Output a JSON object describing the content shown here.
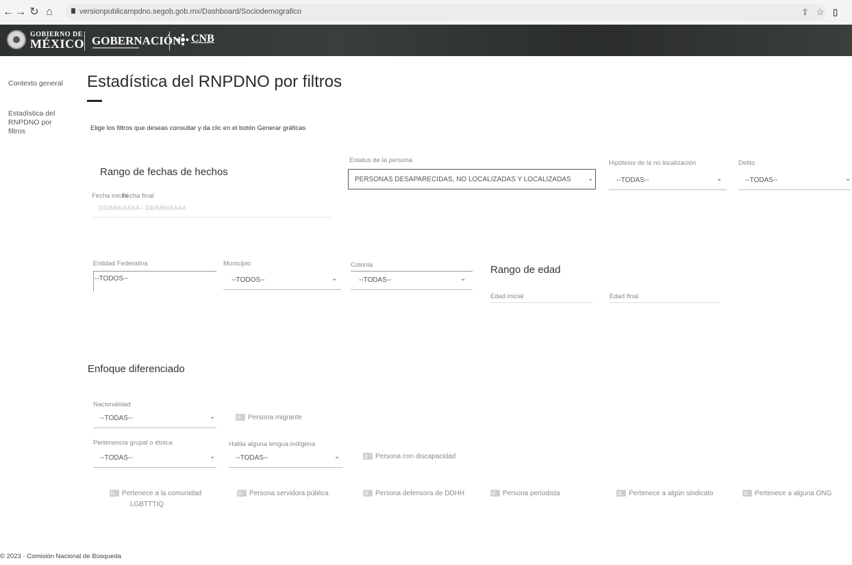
{
  "browser": {
    "url": "versionpublicampdno.segob.gob.mx/Dashboard/Sociodemografico",
    "icons": [
      "back-icon",
      "forward-icon",
      "reload-icon",
      "home-icon",
      "lock-icon",
      "share-icon",
      "star-icon",
      "sidebar-icon"
    ]
  },
  "header": {
    "gob_line1": "GOBIERNO DE",
    "gob_line2": "MÉXICO",
    "gobernacion": "GOBERNACIÓN",
    "cnb": "CNB"
  },
  "sidebar": {
    "items": [
      {
        "label": "Contexto general"
      },
      {
        "label": "Estadística del RNPDNO por filtros"
      }
    ]
  },
  "main": {
    "title": "Estadística del RNPDNO por filtros",
    "instructions": "Elige los filtros que deseas consultar y da clic en el botón Generar gráficas",
    "fechas": {
      "title": "Rango de fechas de hechos",
      "inicial_label": "Fecha inicial",
      "final_label": "Fecha final",
      "placeholder": "DD/MM/AAAA - DD/MM/AAAA"
    },
    "estatus": {
      "label": "Estatus de la persona",
      "value": "PERSONAS DESAPARECIDAS, NO LOCALIZADAS Y LOCALIZADAS"
    },
    "hipotesis": {
      "label": "Hipótesis de la no localización",
      "value": "--TODAS--"
    },
    "delito": {
      "label": "Delito",
      "value": "--TODAS--"
    },
    "entidad": {
      "label": "Entidad Federativa",
      "value": "--TODOS--"
    },
    "municipio": {
      "label": "Municipio",
      "value": "--TODOS--"
    },
    "colonia": {
      "label": "Colonia",
      "value": "--TODAS--"
    },
    "edad": {
      "title": "Rango de edad",
      "inicial_label": "Edad inicial",
      "final_label": "Edad final"
    },
    "enfoque": {
      "title": "Enfoque diferenciado",
      "nacionalidad": {
        "label": "Nacionalidad",
        "value": "--TODAS--"
      },
      "migrante": "Persona migrante",
      "pertenencia": {
        "label": "Pertenencia grupal o étnica",
        "value": "--TODAS--"
      },
      "lengua": {
        "label": "Habla alguna lengua indígena",
        "value": "--TODAS--"
      },
      "discapacidad": "Persona con discapacidad",
      "lgbttiq_line1": "Pertenece a la comunidad",
      "lgbttiq_line2": "LGBTTTIQ",
      "servidora": "Persona servidora pública",
      "defensora": "Persona defensora de DDHH",
      "periodista": "Persona periodista",
      "sindicato": "Pertenece a algún sindicato",
      "ong": "Pertenece a alguna ONG"
    }
  },
  "footer": {
    "text": "© 2023 · Comisión Nacional de Búsqueda"
  },
  "colors": {
    "banner": "#2e322f",
    "text": "#333333",
    "muted": "#888888",
    "toggle": "#cfcfcf"
  }
}
